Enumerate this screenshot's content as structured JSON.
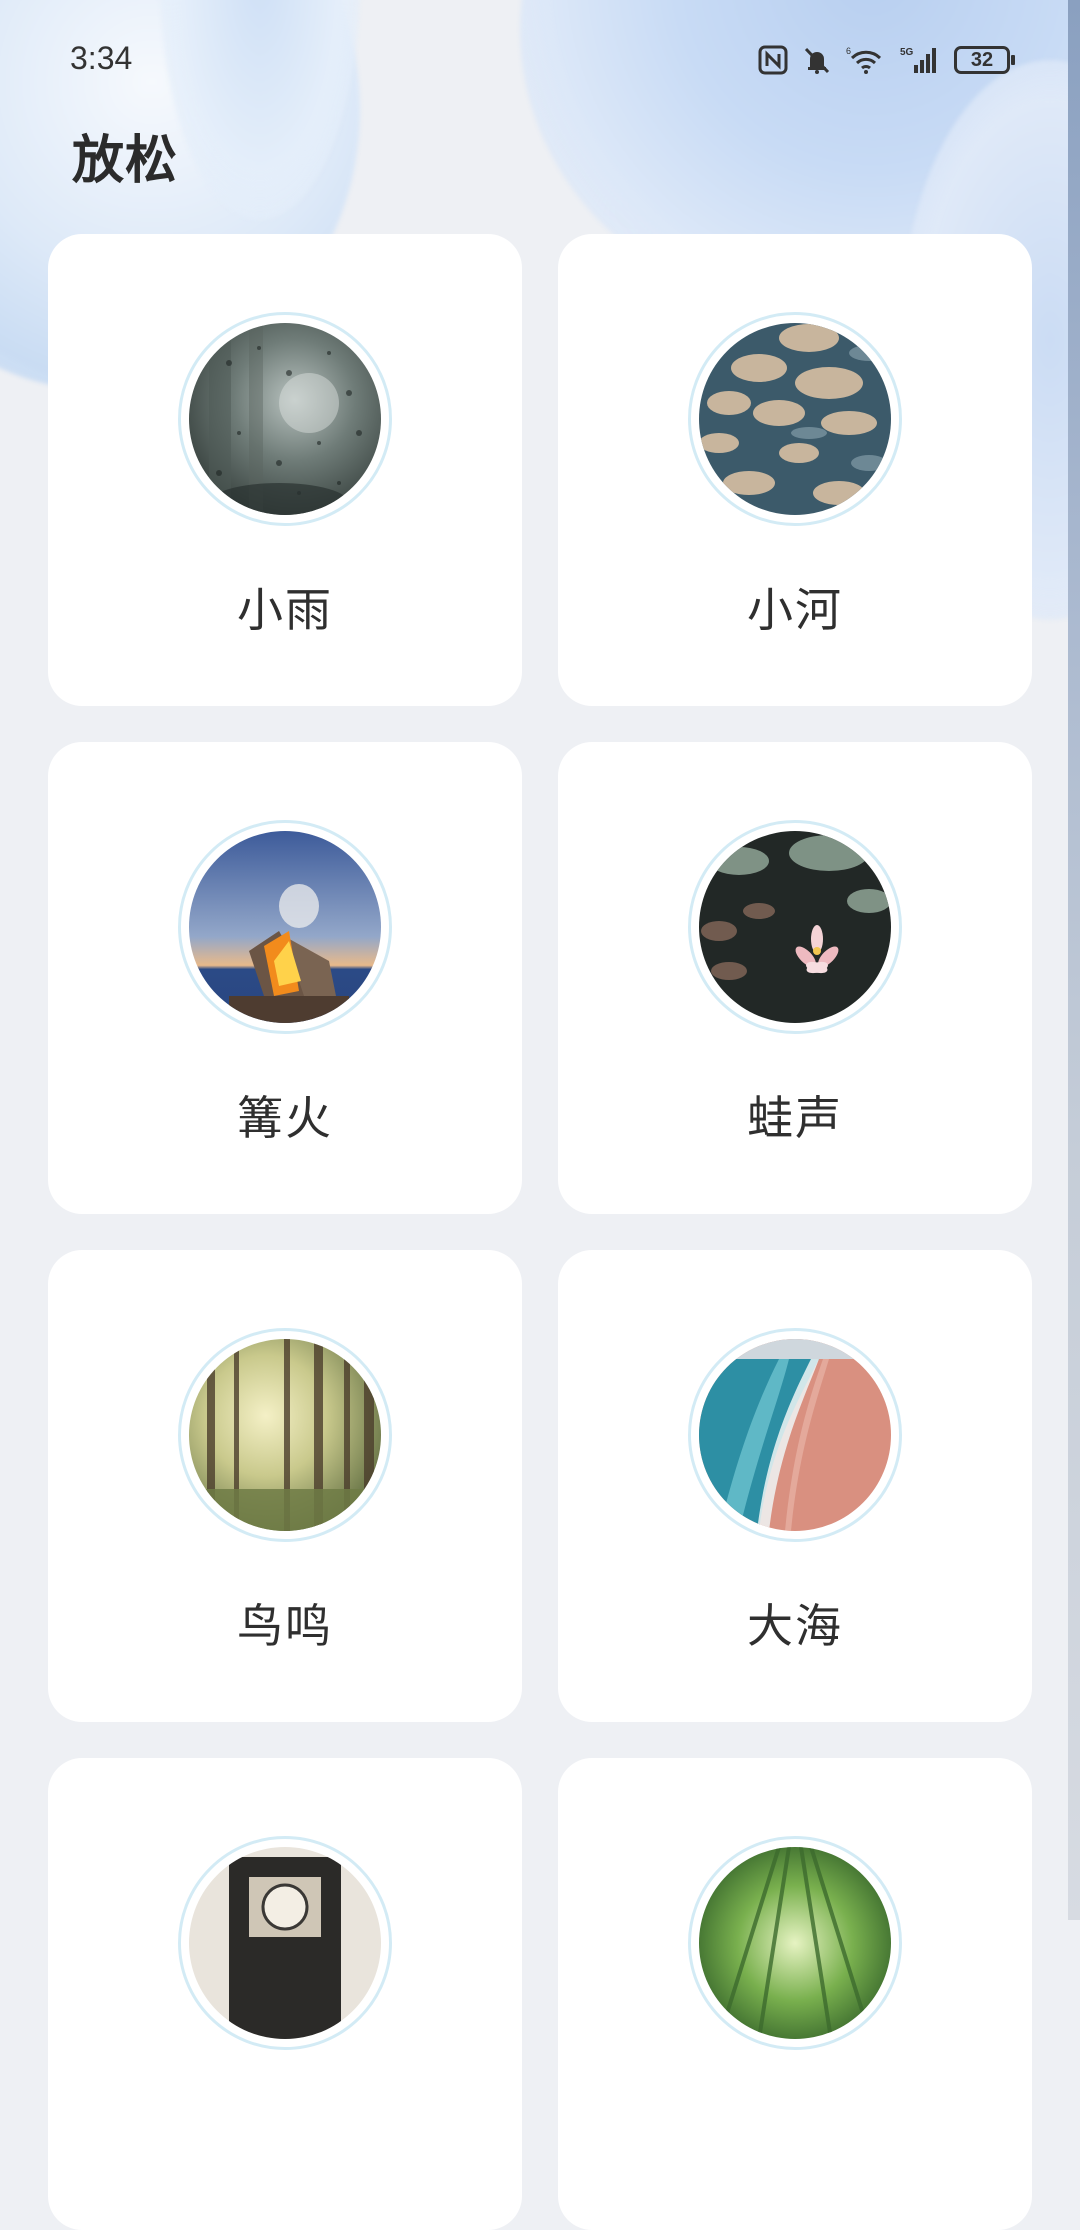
{
  "status_bar": {
    "time": "3:34",
    "battery_level": "32",
    "icons": [
      "nfc-icon",
      "bell-muted-icon",
      "wifi-icon",
      "signal-5g-icon",
      "battery-icon"
    ]
  },
  "header": {
    "title": "放松"
  },
  "colors": {
    "background": "#eef0f4",
    "card": "#ffffff",
    "ring": "#d3ebf5",
    "text": "#2f2f2f"
  },
  "sounds": [
    {
      "label": "小雨",
      "image": "rainy-window-image"
    },
    {
      "label": "小河",
      "image": "river-stones-image"
    },
    {
      "label": "篝火",
      "image": "campfire-image"
    },
    {
      "label": "蛙声",
      "image": "lotus-pond-image"
    },
    {
      "label": "鸟鸣",
      "image": "forest-image"
    },
    {
      "label": "大海",
      "image": "ocean-beach-image"
    },
    {
      "label": "",
      "image": "clock-image"
    },
    {
      "label": "",
      "image": "bamboo-forest-image"
    }
  ]
}
